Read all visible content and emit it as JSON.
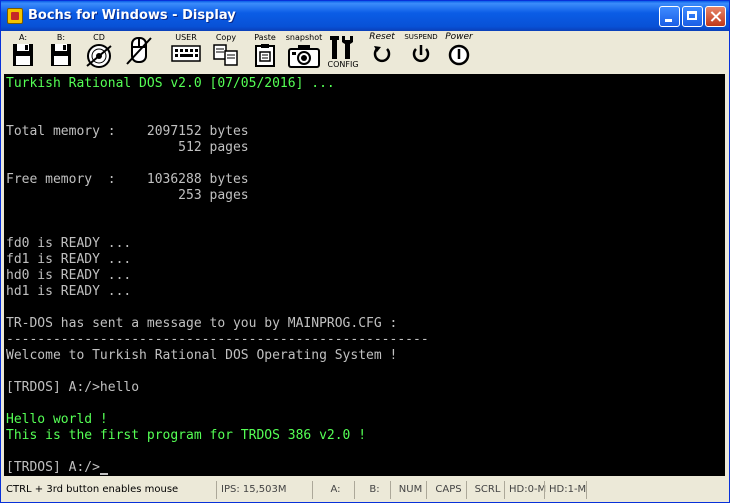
{
  "window": {
    "title": "Bochs for Windows - Display"
  },
  "toolbar": {
    "floppy_a_label": "A:",
    "floppy_b_label": "B:",
    "cdrom_label": "CD",
    "user_label": "USER",
    "copy_label": "Copy",
    "paste_label": "Paste",
    "snapshot_label": "snapshot",
    "config_label": "CONFIG",
    "reset_label": "Reset",
    "suspend_label": "SUSPEND",
    "power_label": "Power"
  },
  "console": {
    "lines": [
      "Turkish Rational DOS v2.0 [07/05/2016] ...",
      "Total memory :    2097152 bytes",
      "                      512 pages",
      "Free memory  :    1036288 bytes",
      "                      253 pages",
      "fd0 is READY ...",
      "fd1 is READY ...",
      "hd0 is READY ...",
      "hd1 is READY ...",
      "TR-DOS has sent a message to you by MAINPROG.CFG :",
      "------------------------------------------------------",
      "Welcome to Turkish Rational DOS Operating System !",
      "[TRDOS] A:/>hello",
      "Hello world !",
      "This is the first program for TRDOS 386 v2.0 !",
      "[TRDOS] A:/>"
    ],
    "text_color": "#c0c0c0",
    "highlight_color": "#55ff55"
  },
  "statusbar": {
    "hint": "CTRL + 3rd button enables mouse",
    "ips": "IPS: 15,503M",
    "drive_a": "A:",
    "drive_b": "B:",
    "num": "NUM",
    "caps": "CAPS",
    "scrl": "SCRL",
    "hd0": "HD:0-M",
    "hd1": "HD:1-M"
  }
}
